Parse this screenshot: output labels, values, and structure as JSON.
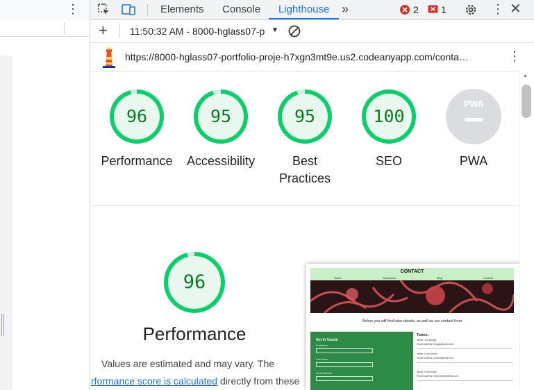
{
  "devtools": {
    "tabs": [
      "Elements",
      "Console",
      "Lighthouse"
    ],
    "active_tab": "Lighthouse",
    "errors_count": "2",
    "issues_count": "1",
    "accent": "#1a73e8"
  },
  "toolbar": {
    "report_select": "11:50:32 AM - 8000-hglass07-p"
  },
  "report": {
    "url": "https://8000-hglass07-portfolio-proje-h7xgn3mt9e.us2.codeanyapp.com/conta…"
  },
  "scores": [
    {
      "label": "Performance",
      "score": 96
    },
    {
      "label": "Accessibility",
      "score": 95
    },
    {
      "label": "Best Practices",
      "score": 95
    },
    {
      "label": "SEO",
      "score": 100
    }
  ],
  "pwa": {
    "label": "PWA",
    "badge": "PWA"
  },
  "score_color": "#0cce6b",
  "performance_section": {
    "score": 96,
    "title": "Performance",
    "note_line1": "Values are estimated and may vary. The",
    "link_text": "rformance score is calculated",
    "note_line2_rest": " directly from these"
  },
  "thumbnail": {
    "title": "CONTACT",
    "nav": [
      "Home",
      "Resources",
      "Blog",
      "Contact"
    ],
    "subtitle": "Below you will find tutor details, as well as our contact form",
    "form_title": "Get In Touch!",
    "form_fields": [
      "First Name:",
      "Last Name:",
      "Email Address:"
    ],
    "tutors_title": "Tutors:",
    "tutors": [
      {
        "name": "Name: Joe Bloggs",
        "email": "Email Address: bloggs@gmail.com"
      },
      {
        "name": "Name: Linda Smith",
        "email": "Email Address: lsmith@gmail.com"
      },
      {
        "name": "Name: Hugh Mann",
        "email": "Email Address: h@nmann@gmail.com"
      }
    ]
  }
}
